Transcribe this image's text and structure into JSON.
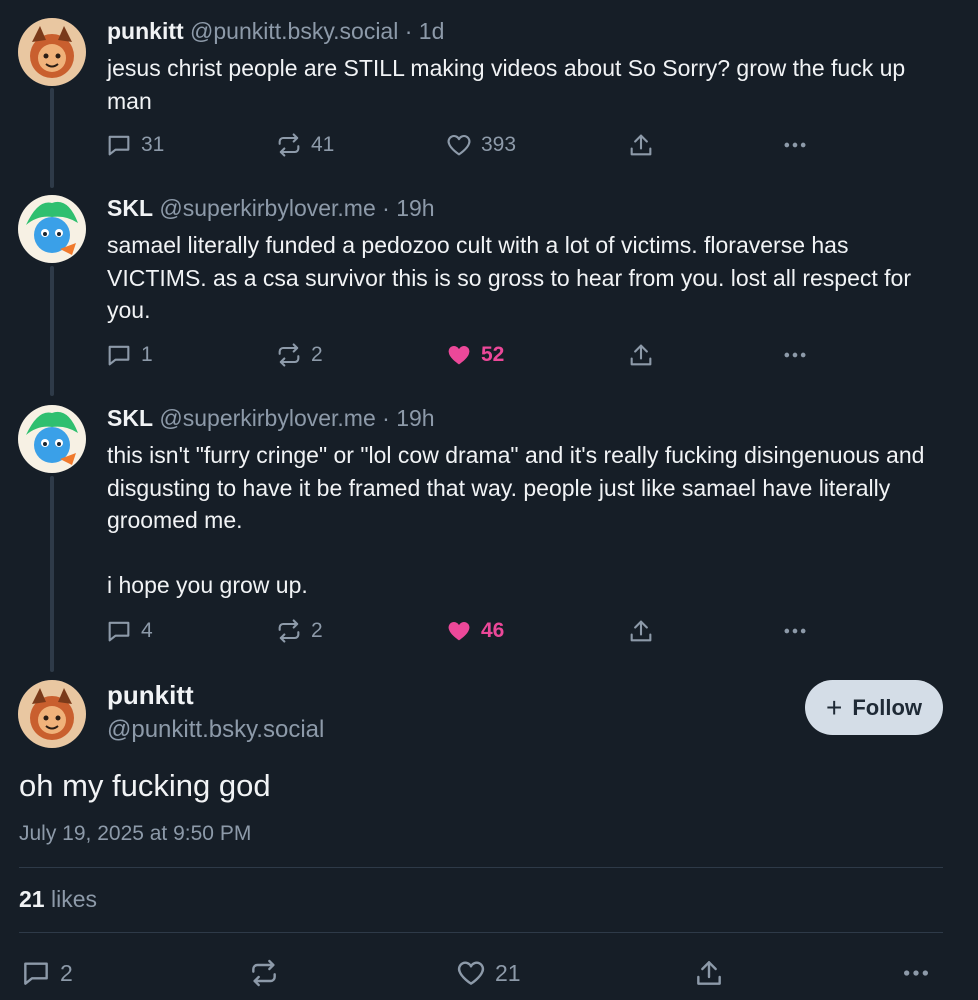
{
  "thread": [
    {
      "author": "punkitt",
      "handle": "@punkitt.bsky.social",
      "sep": "·",
      "time": "1d",
      "paragraphs": [
        "jesus christ people are STILL making videos about So Sorry? grow the fuck up man"
      ],
      "replies": "31",
      "reposts": "41",
      "likes": "393",
      "liked": false
    },
    {
      "author": "SKL",
      "handle": "@superkirbylover.me",
      "sep": "·",
      "time": "19h",
      "paragraphs": [
        "samael literally funded a pedozoo cult with a lot of victims. floraverse has VICTIMS. as a csa survivor this is so gross to hear from you. lost all respect for you."
      ],
      "replies": "1",
      "reposts": "2",
      "likes": "52",
      "liked": true
    },
    {
      "author": "SKL",
      "handle": "@superkirbylover.me",
      "sep": "·",
      "time": "19h",
      "paragraphs": [
        "this isn't \"furry cringe\" or \"lol cow drama\" and it's really fucking disingenuous and disgusting to have it be framed that way. people just like samael have literally groomed me.",
        "i hope you grow up."
      ],
      "replies": "4",
      "reposts": "2",
      "likes": "46",
      "liked": true
    }
  ],
  "main_post": {
    "author": "punkitt",
    "handle": "@punkitt.bsky.social",
    "follow_label": "Follow",
    "follow_icon": "+",
    "text": "oh my fucking god",
    "timestamp": "July 19, 2025 at 9:50 PM",
    "likes_count": "21",
    "likes_label": "likes",
    "replies": "2",
    "likes": "21"
  },
  "colors": {
    "background": "#161e27",
    "muted": "#8d9aa9",
    "like_accent": "#ec4899",
    "follow_bg": "#d4dde7"
  },
  "icons": {
    "reply": "speech-bubble-icon",
    "repost": "repost-arrows-icon",
    "like": "heart-icon",
    "share": "share-upload-icon",
    "more": "ellipsis-icon",
    "follow": "plus-icon"
  }
}
